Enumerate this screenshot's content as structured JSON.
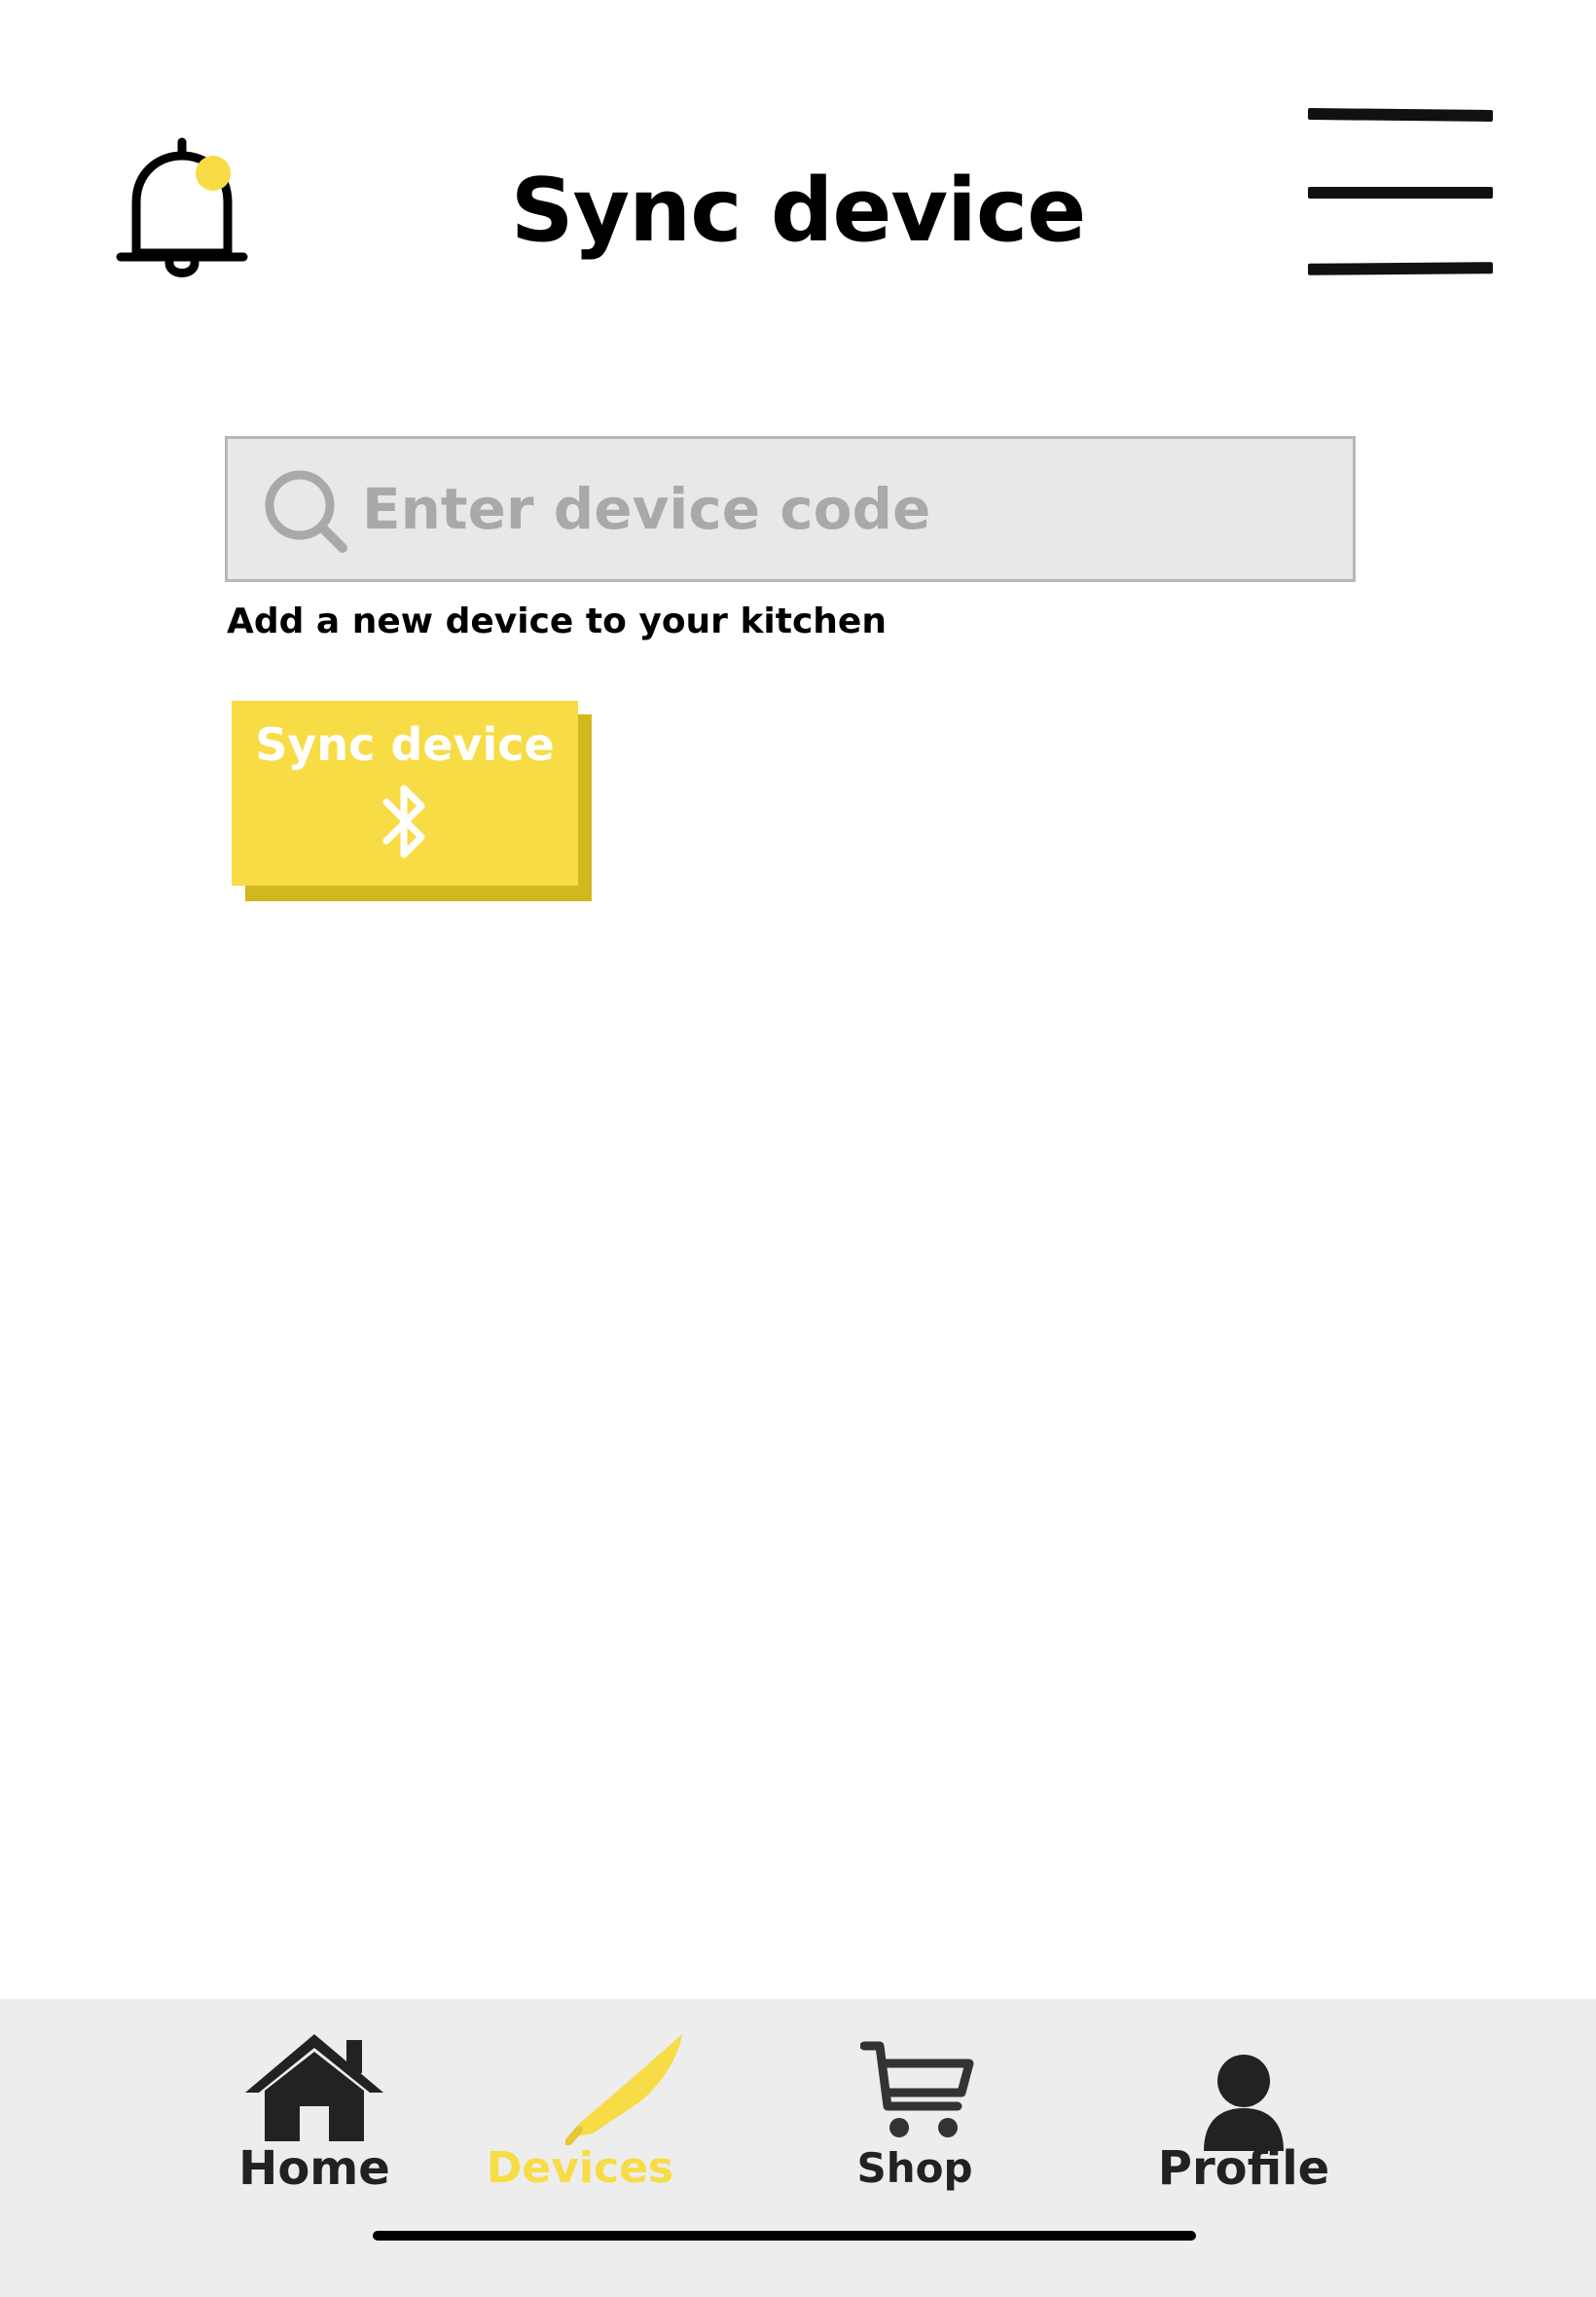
{
  "header": {
    "title": "Sync device",
    "notification_icon": "bell-icon",
    "notification_dot_color": "#f7dc45",
    "menu_icon": "hamburger-menu-icon"
  },
  "search": {
    "placeholder": "Enter device code",
    "value": "",
    "icon": "search-icon"
  },
  "helper_text": "Add a new device to your kitchen",
  "sync_button": {
    "label": "Sync device",
    "icon": "bluetooth-icon",
    "color": "#f7dc45",
    "shadow_color": "#d1b81e"
  },
  "nav": {
    "active_color": "#f7dc45",
    "items": [
      {
        "label": "Home",
        "icon": "home-icon",
        "active": false
      },
      {
        "label": "Devices",
        "icon": "knife-icon",
        "active": true
      },
      {
        "label": "Shop",
        "icon": "shopping-cart-icon",
        "active": false
      },
      {
        "label": "Profile",
        "icon": "user-icon",
        "active": false
      }
    ]
  }
}
